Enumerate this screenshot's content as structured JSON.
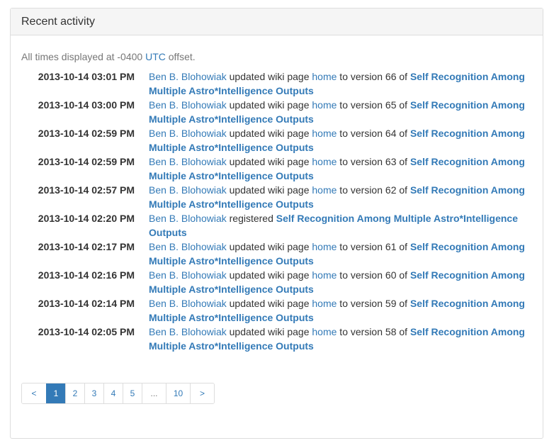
{
  "panel": {
    "title": "Recent activity"
  },
  "tz_note": {
    "prefix": "All times displayed at -0400 ",
    "link": "UTC",
    "suffix": " offset."
  },
  "project": "Self Recognition Among Multiple Astro*Intelligence Outputs",
  "activity": [
    {
      "time": "2013-10-14 03:01 PM",
      "user": "Ben B. Blohowiak",
      "action": "updated wiki page",
      "page": "home",
      "version": "66"
    },
    {
      "time": "2013-10-14 03:00 PM",
      "user": "Ben B. Blohowiak",
      "action": "updated wiki page",
      "page": "home",
      "version": "65"
    },
    {
      "time": "2013-10-14 02:59 PM",
      "user": "Ben B. Blohowiak",
      "action": "updated wiki page",
      "page": "home",
      "version": "64"
    },
    {
      "time": "2013-10-14 02:59 PM",
      "user": "Ben B. Blohowiak",
      "action": "updated wiki page",
      "page": "home",
      "version": "63"
    },
    {
      "time": "2013-10-14 02:57 PM",
      "user": "Ben B. Blohowiak",
      "action": "updated wiki page",
      "page": "home",
      "version": "62"
    },
    {
      "time": "2013-10-14 02:20 PM",
      "user": "Ben B. Blohowiak",
      "action": "registered",
      "page": "",
      "version": ""
    },
    {
      "time": "2013-10-14 02:17 PM",
      "user": "Ben B. Blohowiak",
      "action": "updated wiki page",
      "page": "home",
      "version": "61"
    },
    {
      "time": "2013-10-14 02:16 PM",
      "user": "Ben B. Blohowiak",
      "action": "updated wiki page",
      "page": "home",
      "version": "60"
    },
    {
      "time": "2013-10-14 02:14 PM",
      "user": "Ben B. Blohowiak",
      "action": "updated wiki page",
      "page": "home",
      "version": "59"
    },
    {
      "time": "2013-10-14 02:05 PM",
      "user": "Ben B. Blohowiak",
      "action": "updated wiki page",
      "page": "home",
      "version": "58"
    }
  ],
  "text": {
    "to_version": " to version ",
    "of": " of "
  },
  "pagination": {
    "prev": "<",
    "pages": [
      "1",
      "2",
      "3",
      "4",
      "5",
      "...",
      "10"
    ],
    "next": ">",
    "active": "1"
  },
  "colors": {
    "link": "#337ab7",
    "heading_bg": "#f5f5f5",
    "border": "#dddddd"
  }
}
